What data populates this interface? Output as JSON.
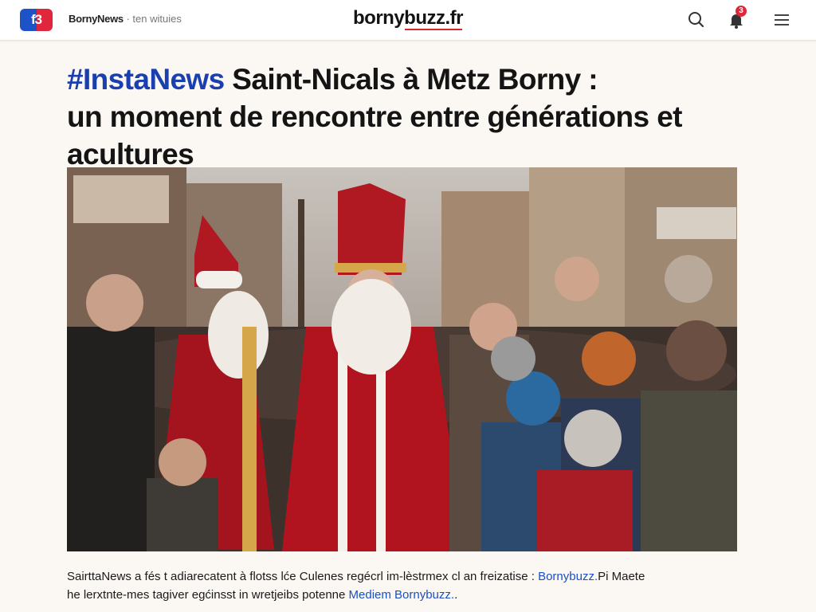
{
  "header": {
    "logo_text": "f3",
    "site_name": "BornyNews",
    "site_subtitle": "· ten wituies",
    "brand": "bornybuzz.fr",
    "notification_count": "3",
    "icons": {
      "search": "search-icon",
      "notifications": "bell-icon",
      "menu": "hamburger-menu-icon"
    }
  },
  "article": {
    "hashtag": "#InstaNews",
    "headline_line1": " Saint-Nicals à Metz Borny :",
    "headline_line2": "un moment de rencontre entre générations et",
    "headline_line3": "acultures",
    "caption_line1_text": "SairttaNews a fés t adiarecatent à flotss lće  Culenes regécrl im-lèstrmex cl an freizatise : ",
    "caption_line1_link": "Bornybuzz.",
    "caption_line1_tail": "Pi Maete",
    "caption_line2_text": "he lerxtnte-mes tagiver egćinsst in wretjeibs potenne ",
    "caption_line2_link": "Mediem Bornybuzz.",
    "caption_line2_tail": "."
  },
  "colors": {
    "accent_blue": "#1a3fae",
    "link_blue": "#1a4fc4",
    "brand_red": "#d9232f",
    "background": "#fbf8f3"
  }
}
